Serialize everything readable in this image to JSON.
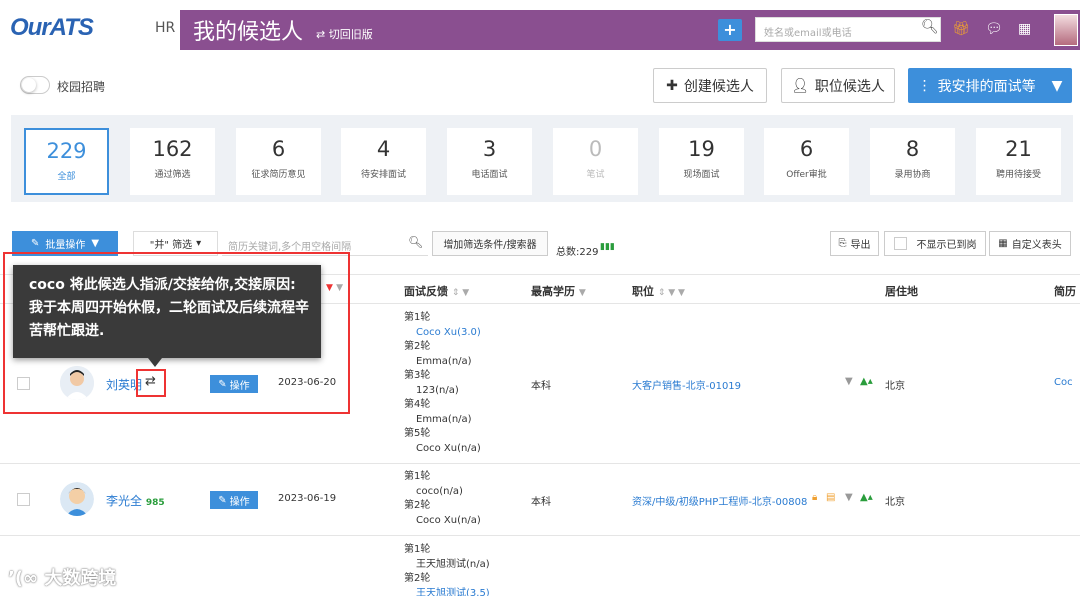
{
  "app": {
    "logo": "OurATS",
    "role": "HR",
    "title": "我的候选人",
    "switch_old": "切回旧版"
  },
  "topbar": {
    "add_label": "+",
    "search_placeholder": "姓名或email或电话"
  },
  "campus_label": "校园招聘",
  "actions": {
    "create": "创建候选人",
    "position": "职位候选人",
    "my_interviews": "我安排的面试等"
  },
  "stats": [
    {
      "n": "229",
      "l": "全部"
    },
    {
      "n": "162",
      "l": "通过筛选"
    },
    {
      "n": "6",
      "l": "征求简历意见"
    },
    {
      "n": "4",
      "l": "待安排面试"
    },
    {
      "n": "3",
      "l": "电话面试"
    },
    {
      "n": "0",
      "l": "笔试"
    },
    {
      "n": "19",
      "l": "现场面试"
    },
    {
      "n": "6",
      "l": "Offer审批"
    },
    {
      "n": "8",
      "l": "录用协商"
    },
    {
      "n": "21",
      "l": "聘用待接受"
    }
  ],
  "toolbar": {
    "batch": "批量操作",
    "and_filter": "\"并\" 筛选",
    "kw_placeholder": "简历关键词,多个用空格间隔",
    "add_filter": "增加筛选条件/搜索器",
    "total": "总数:229",
    "export": "导出",
    "hide_job": "不显示已到岗",
    "custom_header": "自定义表头"
  },
  "columns": {
    "feedback": "面试反馈",
    "education": "最高学历",
    "position": "职位",
    "location": "居住地",
    "resume": "简历"
  },
  "tooltip": {
    "text": "coco 将此候选人指派/交接给你,交接原因:我于本周四开始休假，二轮面试及后续流程辛苦帮忙跟进."
  },
  "rows": [
    {
      "name": "刘英明",
      "op": "操作",
      "date": "2023-06-20",
      "feedback": [
        {
          "round": "第1轮",
          "who": "Coco Xu(3.0)",
          "blue": true
        },
        {
          "round": "第2轮",
          "who": "Emma(n/a)",
          "blue": false
        },
        {
          "round": "第3轮",
          "who": "123(n/a)",
          "blue": false
        },
        {
          "round": "第4轮",
          "who": "Emma(n/a)",
          "blue": false
        },
        {
          "round": "第5轮",
          "who": "Coco Xu(n/a)",
          "blue": false
        }
      ],
      "education": "本科",
      "job": "大客户销售-北京-01019",
      "location": "北京",
      "resume": "Coc"
    },
    {
      "name": "李光全",
      "score": "985",
      "op": "操作",
      "date": "2023-06-19",
      "feedback": [
        {
          "round": "第1轮",
          "who": "coco(n/a)",
          "blue": false
        },
        {
          "round": "第2轮",
          "who": "Coco Xu(n/a)",
          "blue": false
        }
      ],
      "education": "本科",
      "job": "资深/中级/初级PHP工程师-北京-00808",
      "location": "北京"
    },
    {
      "feedback": [
        {
          "round": "第1轮",
          "who": "王天旭测试(n/a)",
          "blue": false
        },
        {
          "round": "第2轮",
          "who": "王天旭测试(3.5)",
          "blue": true
        }
      ]
    }
  ],
  "watermark": "大数跨境",
  "colors": {
    "purple": "#8a4f90",
    "accent": "#3d8fdb",
    "red": "#e33333"
  }
}
